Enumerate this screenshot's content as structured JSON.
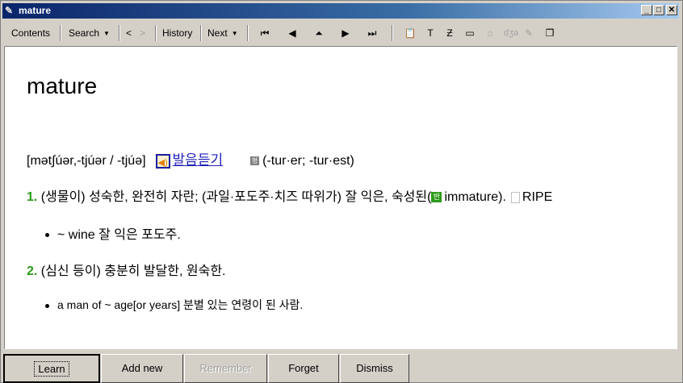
{
  "window": {
    "title": "mature"
  },
  "toolbar": {
    "contents": "Contents",
    "search": "Search",
    "back": "<",
    "forward": ">",
    "history": "History",
    "next": "Next"
  },
  "entry": {
    "headword": "mature",
    "pronunciation": "[mət∫úər,-tjúər / -tjúə]",
    "listen": "발음듣기",
    "inflection_mark": "형",
    "inflections": "(-tur·er; -tur·est)",
    "senses": [
      {
        "number": "1.",
        "text": "(생물이) 성숙한, 완전히 자란; (과일·포도주·치즈 따위가) 잘 익은, 숙성된(",
        "antonym_mark": "반",
        "antonym": "immature).",
        "synonym": "RIPE",
        "example": "~ wine 잘 익은 포도주."
      },
      {
        "number": "2.",
        "text": "(심신 등이) 충분히 발달한, 원숙한.",
        "example": "a man of ~ age[or years] 분별 있는 연령이 된 사람."
      }
    ]
  },
  "buttons": {
    "learn": "Learn",
    "add_new": "Add new",
    "remember": "Remember",
    "forget": "Forget",
    "dismiss": "Dismiss"
  },
  "icons": {
    "app": "book-icon",
    "first": "first-page-icon",
    "prev": "previous-icon",
    "up": "up-icon",
    "next": "next-icon",
    "last": "last-page-icon",
    "paste": "clipboard-icon",
    "text": "text-icon",
    "format": "format-icon",
    "card": "card-icon",
    "tray": "tray-icon",
    "phonetic": "phonetic-icon",
    "tools": "tools-icon",
    "windows": "windows-icon"
  }
}
